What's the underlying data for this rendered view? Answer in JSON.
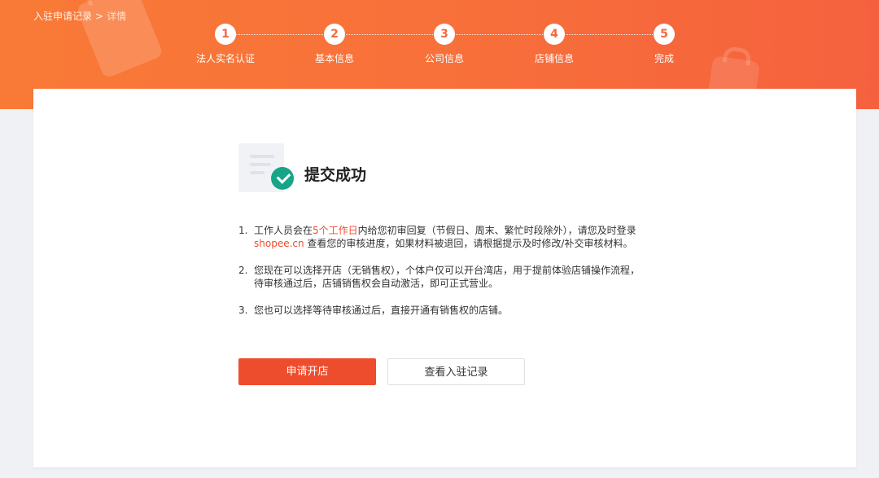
{
  "breadcrumb": {
    "parent": "入驻申请记录",
    "separator": ">",
    "current": "详情"
  },
  "steps": [
    {
      "number": "1",
      "label": "法人实名认证"
    },
    {
      "number": "2",
      "label": "基本信息"
    },
    {
      "number": "3",
      "label": "公司信息"
    },
    {
      "number": "4",
      "label": "店铺信息"
    },
    {
      "number": "5",
      "label": "完成"
    }
  ],
  "result": {
    "title": "提交成功",
    "icons": [
      "document-icon",
      "check-circle-icon"
    ],
    "accent_color": "#17a589"
  },
  "instructions": [
    {
      "num": "1.",
      "line1_before": "工作人员会在",
      "line1_highlight": "5个工作日",
      "line1_after": "内给您初审回复（节假日、周末、繁忙时段除外），请您及时登录",
      "line2_link": "shopee.cn",
      "line2_after": " 查看您的审核进度，如果材料被退回，请根据提示及时修改/补交审核材料。"
    },
    {
      "num": "2.",
      "line1": "您现在可以选择开店（无销售权），个体户仅可以开台湾店，用于提前体验店铺操作流程，",
      "line2": "待审核通过后，店铺销售权会自动激活，即可正式营业。"
    },
    {
      "num": "3.",
      "line1": "您也可以选择等待审核通过后，直接开通有销售权的店铺。"
    }
  ],
  "buttons": {
    "primary": "申请开店",
    "secondary": "查看入驻记录"
  },
  "colors": {
    "brand": "#ee4d2d",
    "banner_start": "#f97a36",
    "banner_end": "#f5613e",
    "success": "#17a589"
  }
}
